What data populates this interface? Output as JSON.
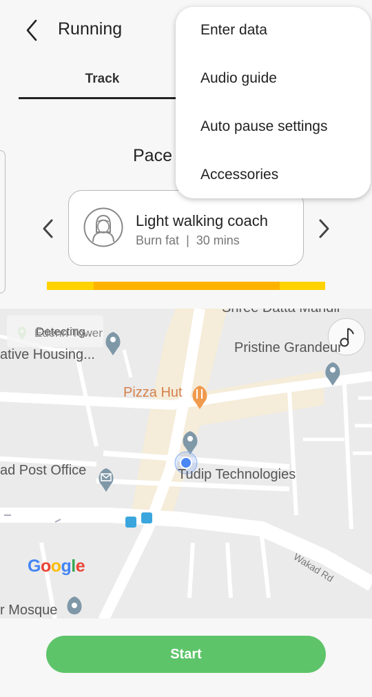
{
  "header": {
    "title": "Running"
  },
  "tabs": [
    {
      "label": "Track"
    }
  ],
  "workout": {
    "target_label": "Pace",
    "coach": {
      "name": "Light walking coach",
      "goal": "Burn fat",
      "duration": "30 mins"
    }
  },
  "menu": {
    "items": [
      {
        "label": "Enter data"
      },
      {
        "label": "Audio guide"
      },
      {
        "label": "Auto pause settings"
      },
      {
        "label": "Accessories"
      }
    ]
  },
  "map": {
    "status": "Detecting...",
    "places": {
      "shree_datta": "Shree Datta Mandir",
      "edenn_tower": "Edenn Tower",
      "housing": "ative Housing...",
      "pristine": "Pristine Grandeur",
      "pizza_hut": "Pizza Hut",
      "post_office": "ad Post Office",
      "tudip": "Tudip Technologies",
      "wakad_rd": "Wakad Rd",
      "mosque": "r Mosque"
    },
    "attribution": "Google"
  },
  "actions": {
    "start_label": "Start"
  },
  "colors": {
    "accent_green": "#5ec46a",
    "pace_yellow": "#ffd200",
    "pace_orange": "#ffb300",
    "location_blue": "#4a86f4",
    "pin_blue": "#7f98a8",
    "pizza_orange": "#f09a4e"
  }
}
